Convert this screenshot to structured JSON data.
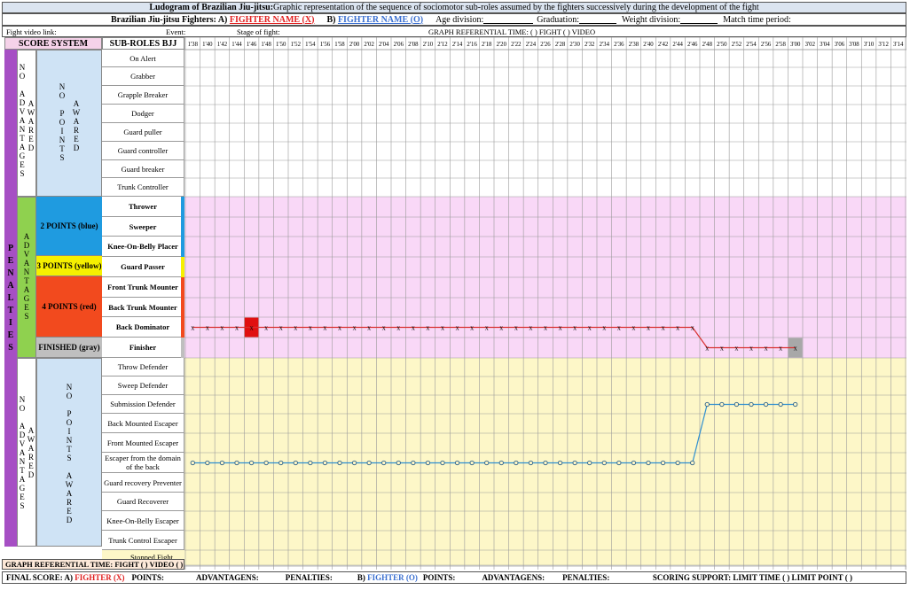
{
  "header": {
    "title_bold": "Ludogram of Brazilian Jiu-jitsu:",
    "title_rest": " Graphic representation of the sequence of sociomotor sub-roles assumed by the fighters successively during the development of the fight",
    "fighters_label": "Brazilian Jiu-jitsu Fighters: A)",
    "fighter_a": "FIGHTER NAME (X)",
    "fighter_b_prefix": "B)",
    "fighter_b": "FIGHTER NAME (O)",
    "age": "Age division:",
    "graduation": "Graduation:",
    "weight": "Weight division:",
    "match_time": "Match time period:",
    "video_link": "Fight video link:",
    "event": "Event:",
    "stage": "Stage of fight:",
    "graph_ref": "GRAPH REFERENTIAL TIME:  (   ) FIGHT      (   ) VIDEO"
  },
  "left": {
    "score_system": "SCORE SYSTEM",
    "sub_roles": "SUB-ROLES BJJ",
    "penalties": "PENALTIES",
    "no_adv": "NO ADVANTAGES",
    "no_adv_awarded": "AWARED",
    "advantages": "ADVANTAGES",
    "no_points_awarded": "NO POINTS AWARED",
    "two_points": "2 POINTS (blue)",
    "three_points": "3 POINTS (yellow)",
    "four_points": "4 POINTS (red)",
    "finished": "FINISHED (gray)",
    "no_points_awarded2": "NO POINTS AWARED"
  },
  "roles": [
    "On Alert",
    "Grabber",
    "Grapple Breaker",
    "Dodger",
    "Guard puller",
    "Guard controller",
    "Guard breaker",
    "Trunk Controller",
    "Thrower",
    "Sweeper",
    "Knee-On-Belly Placer",
    "Guard Passer",
    "Front Trunk Mounter",
    "Back Trunk Mounter",
    "Back Dominator",
    "Finisher",
    "Throw Defender",
    "Sweep Defender",
    "Submission Defender",
    "Back Mounted Escaper",
    "Front Mounted Escaper",
    "Escaper from the domain of the back",
    "Guard recovery Preventer",
    "Guard Recoverer",
    "Knee-On-Belly Escaper",
    "Trunk Control Escaper",
    "Stopped Fight"
  ],
  "times": [
    "1'38",
    "1'40",
    "1'42",
    "1'44",
    "1'46",
    "1'48",
    "1'50",
    "1'52",
    "1'54",
    "1'56",
    "1'58",
    "2'00",
    "2'02",
    "2'04",
    "2'06",
    "2'08",
    "2'10",
    "2'12",
    "2'14",
    "2'16",
    "2'18",
    "2'20",
    "2'22",
    "2'24",
    "2'26",
    "2'28",
    "2'30",
    "2'32",
    "2'34",
    "2'36",
    "2'38",
    "2'40",
    "2'42",
    "2'44",
    "2'46",
    "2'48",
    "2'50",
    "2'52",
    "2'54",
    "2'56",
    "2'58",
    "3'00",
    "3'02",
    "3'04",
    "3'06",
    "3'08",
    "3'10",
    "3'12",
    "3'14"
  ],
  "footer": {
    "graph_ref": "GRAPH REFERENTIAL TIME: FIGHT (  )  VIDEO (  )",
    "final_score": "FINAL SCORE: A)",
    "fighter_x": "FIGHTER (X)",
    "points": "POINTS:",
    "advantages": "ADVANTAGENS:",
    "penalties": "PENALTIES:",
    "b": "B)",
    "fighter_o": "FIGHTER (O)",
    "points2": "POINTS:",
    "advantages2": "ADVANTAGENS:",
    "penalties2": "PENALTIES:",
    "scoring": "SCORING SUPPORT: LIMIT TIME (   )      LIMIT POINT (   )"
  },
  "sequence": {
    "x_marker": "X",
    "o_marker": "O",
    "fighter_x_roles": [
      "Back Dominator",
      "Back Dominator",
      "Back Dominator",
      "Back Dominator",
      "Back Dominator",
      "Back Dominator",
      "Back Dominator",
      "Back Dominator",
      "Back Dominator",
      "Back Dominator",
      "Back Dominator",
      "Back Dominator",
      "Back Dominator",
      "Back Dominator",
      "Back Dominator",
      "Back Dominator",
      "Back Dominator",
      "Back Dominator",
      "Back Dominator",
      "Back Dominator",
      "Back Dominator",
      "Back Dominator",
      "Back Dominator",
      "Back Dominator",
      "Back Dominator",
      "Back Dominator",
      "Back Dominator",
      "Back Dominator",
      "Back Dominator",
      "Back Dominator",
      "Back Dominator",
      "Back Dominator",
      "Back Dominator",
      "Back Dominator",
      "Back Dominator",
      "Finisher",
      "Finisher",
      "Finisher",
      "Finisher",
      "Finisher",
      "Finisher",
      "Finisher"
    ],
    "fighter_o_roles": [
      "Escaper from the domain of the back",
      "Escaper from the domain of the back",
      "Escaper from the domain of the back",
      "Escaper from the domain of the back",
      "Escaper from the domain of the back",
      "Escaper from the domain of the back",
      "Escaper from the domain of the back",
      "Escaper from the domain of the back",
      "Escaper from the domain of the back",
      "Escaper from the domain of the back",
      "Escaper from the domain of the back",
      "Escaper from the domain of the back",
      "Escaper from the domain of the back",
      "Escaper from the domain of the back",
      "Escaper from the domain of the back",
      "Escaper from the domain of the back",
      "Escaper from the domain of the back",
      "Escaper from the domain of the back",
      "Escaper from the domain of the back",
      "Escaper from the domain of the back",
      "Escaper from the domain of the back",
      "Escaper from the domain of the back",
      "Escaper from the domain of the back",
      "Escaper from the domain of the back",
      "Escaper from the domain of the back",
      "Escaper from the domain of the back",
      "Escaper from the domain of the back",
      "Escaper from the domain of the back",
      "Escaper from the domain of the back",
      "Escaper from the domain of the back",
      "Escaper from the domain of the back",
      "Escaper from the domain of the back",
      "Escaper from the domain of the back",
      "Escaper from the domain of the back",
      "Escaper from the domain of the back",
      "Submission Defender",
      "Submission Defender",
      "Submission Defender",
      "Submission Defender",
      "Submission Defender",
      "Submission Defender",
      "Submission Defender"
    ],
    "x_score_highlight_time": "1'46",
    "finish_highlight_time": "3'00"
  },
  "colors": {
    "purple": "#a64fc4",
    "green": "#8fd14f",
    "blue_zone": "#1f9be0",
    "yellow_zone": "#f6f000",
    "red_zone": "#f24a1e",
    "gray_zone": "#bfbfbf",
    "lightblue": "#cfe3f5",
    "pink": "#f9d8f7",
    "cream": "#fdf7c8",
    "x_line": "#d93030",
    "o_line": "#2f8fd0"
  }
}
